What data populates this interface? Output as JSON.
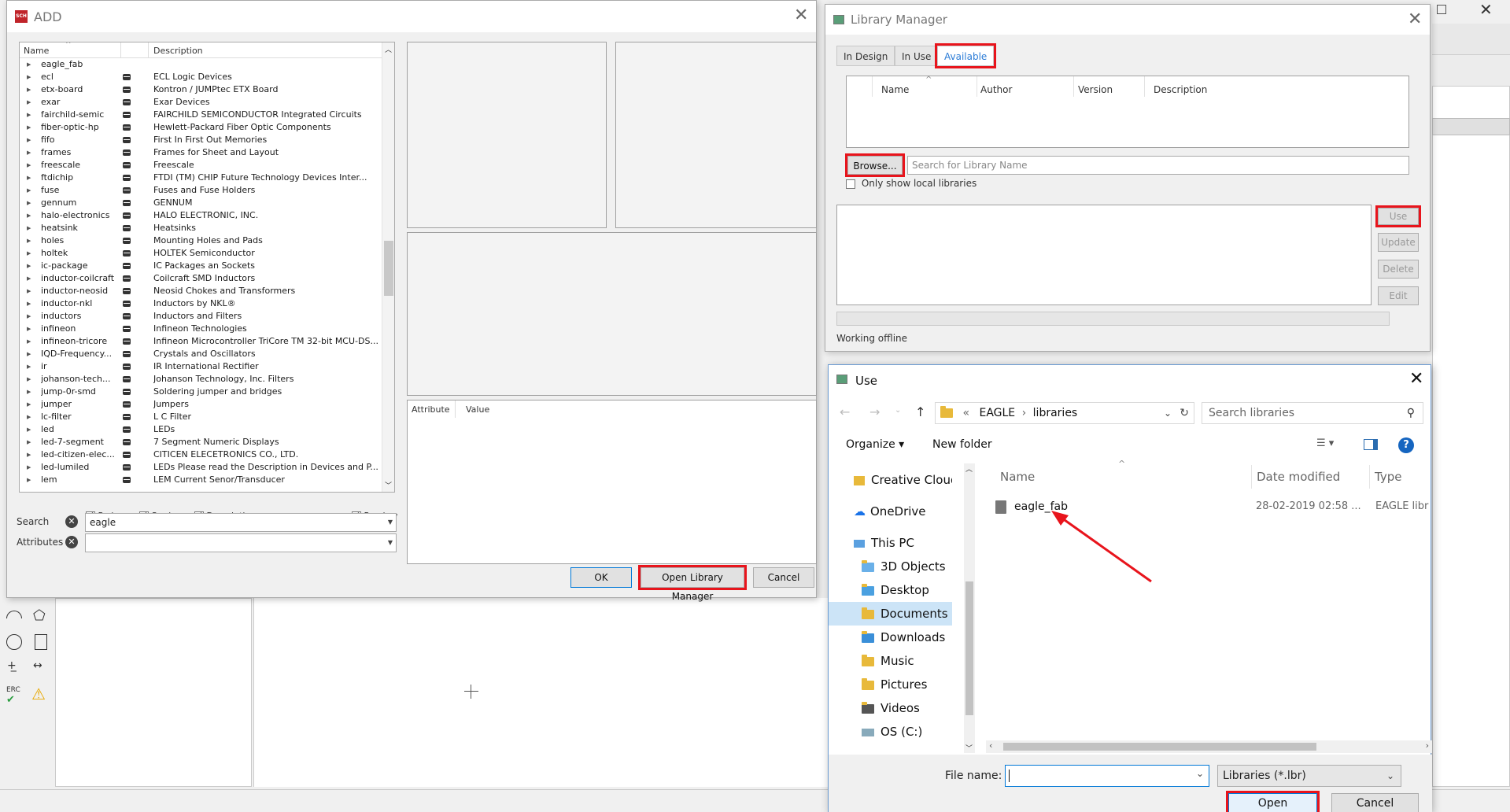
{
  "add_dialog": {
    "title": "ADD",
    "app_icon": "SCH",
    "columns": {
      "name": "Name",
      "description": "Description"
    },
    "rows": [
      {
        "name": "eagle_fab",
        "desc": "",
        "lib": false
      },
      {
        "name": "ecl",
        "desc": "ECL Logic Devices",
        "lib": true
      },
      {
        "name": "etx-board",
        "desc": "Kontron / JUMPtec ETX Board",
        "lib": true
      },
      {
        "name": "exar",
        "desc": "Exar Devices",
        "lib": true
      },
      {
        "name": "fairchild-semic",
        "desc": "FAIRCHILD SEMICONDUCTOR Integrated Circuits",
        "lib": true
      },
      {
        "name": "fiber-optic-hp",
        "desc": "Hewlett-Packard Fiber Optic Components",
        "lib": true
      },
      {
        "name": "fifo",
        "desc": "First In First Out Memories",
        "lib": true
      },
      {
        "name": "frames",
        "desc": "Frames for Sheet and Layout",
        "lib": true
      },
      {
        "name": "freescale",
        "desc": "Freescale",
        "lib": true
      },
      {
        "name": "ftdichip",
        "desc": "FTDI (TM) CHIP Future Technology Devices Inter...",
        "lib": true
      },
      {
        "name": "fuse",
        "desc": "Fuses and Fuse Holders",
        "lib": true
      },
      {
        "name": "gennum",
        "desc": "GENNUM",
        "lib": true
      },
      {
        "name": "halo-electronics",
        "desc": "HALO ELECTRONIC, INC.",
        "lib": true
      },
      {
        "name": "heatsink",
        "desc": "Heatsinks",
        "lib": true
      },
      {
        "name": "holes",
        "desc": "Mounting Holes and Pads",
        "lib": true
      },
      {
        "name": "holtek",
        "desc": "HOLTEK Semiconductor",
        "lib": true
      },
      {
        "name": "ic-package",
        "desc": "IC Packages an Sockets",
        "lib": true
      },
      {
        "name": "inductor-coilcraft",
        "desc": "Coilcraft SMD Inductors",
        "lib": true
      },
      {
        "name": "inductor-neosid",
        "desc": "Neosid Chokes and Transformers",
        "lib": true
      },
      {
        "name": "inductor-nkl",
        "desc": "Inductors by NKL®",
        "lib": true
      },
      {
        "name": "inductors",
        "desc": "Inductors and Filters",
        "lib": true
      },
      {
        "name": "infineon",
        "desc": "Infineon Technologies",
        "lib": true
      },
      {
        "name": "infineon-tricore",
        "desc": "Infineon Microcontroller TriCore TM 32-bit MCU-DS...",
        "lib": true
      },
      {
        "name": "IQD-Frequency...",
        "desc": "Crystals and Oscillators",
        "lib": true
      },
      {
        "name": "ir",
        "desc": "IR International Rectifier",
        "lib": true
      },
      {
        "name": "johanson-tech...",
        "desc": "Johanson Technology, Inc. Filters",
        "lib": true
      },
      {
        "name": "jump-0r-smd",
        "desc": "Soldering jumper and bridges",
        "lib": true
      },
      {
        "name": "jumper",
        "desc": "Jumpers",
        "lib": true
      },
      {
        "name": "lc-filter",
        "desc": "L C Filter",
        "lib": true
      },
      {
        "name": "led",
        "desc": "LEDs",
        "lib": true
      },
      {
        "name": "led-7-segment",
        "desc": "7 Segment Numeric Displays",
        "lib": true
      },
      {
        "name": "led-citizen-elec...",
        "desc": "CITICEN ELECETRONICS CO., LTD.",
        "lib": true
      },
      {
        "name": "led-lumiled",
        "desc": "LEDs Please read the Description in Devices and P...",
        "lib": true
      },
      {
        "name": "lem",
        "desc": "LEM Current Senor/Transducer",
        "lib": true
      }
    ],
    "options": {
      "pads": "Pads",
      "smds": "Smds",
      "description": "Description",
      "preview": "Preview"
    },
    "search_label": "Search",
    "search_value": "eagle",
    "attributes_label": "Attributes",
    "attr_columns": {
      "attribute": "Attribute",
      "value": "Value"
    },
    "ok": "OK",
    "open_library_manager": "Open Library Manager",
    "cancel": "Cancel"
  },
  "library_manager": {
    "title": "Library Manager",
    "tabs": [
      "In Design",
      "In Use",
      "Available"
    ],
    "columns": [
      "Name",
      "Author",
      "Version",
      "Description"
    ],
    "browse": "Browse...",
    "search_placeholder": "Search for Library Name",
    "only_local": "Only show local libraries",
    "use": "Use",
    "update": "Update",
    "delete": "Delete",
    "edit": "Edit",
    "status": "Working offline"
  },
  "use_dialog": {
    "title": "Use",
    "path": [
      "«",
      "EAGLE",
      "libraries"
    ],
    "search_placeholder": "Search libraries",
    "organize": "Organize",
    "new_folder": "New folder",
    "nav": [
      "Creative Cloud Fil",
      "OneDrive",
      "This PC",
      "3D Objects",
      "Desktop",
      "Documents",
      "Downloads",
      "Music",
      "Pictures",
      "Videos",
      "OS (C:)"
    ],
    "columns": {
      "name": "Name",
      "date": "Date modified",
      "type": "Type"
    },
    "file": {
      "name": "eagle_fab",
      "date": "28-02-2019 02:58 ...",
      "type": "EAGLE libr"
    },
    "file_name_label": "File name:",
    "file_type": "Libraries (*.lbr)",
    "open": "Open",
    "cancel": "Cancel"
  },
  "colors": {
    "highlight": "#e8141c",
    "accent": "#2a7bd6",
    "selected_nav": "#cce4f7"
  }
}
